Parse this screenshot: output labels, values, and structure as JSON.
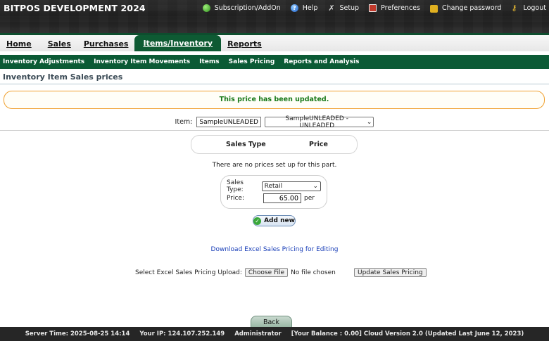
{
  "header": {
    "brand": "BITPOS DEVELOPMENT 2024",
    "links": {
      "subscription": "Subscription/AddOn",
      "help": "Help",
      "setup": "Setup",
      "preferences": "Preferences",
      "change_password": "Change password",
      "logout": "Logout"
    }
  },
  "menu": {
    "home": "Home",
    "sales": "Sales",
    "purchases": "Purchases",
    "items_inventory": "Items/Inventory",
    "reports": "Reports"
  },
  "submenu": {
    "adjustments": "Inventory Adjustments",
    "movements": "Inventory Item Movements",
    "items": "Items",
    "sales_pricing": "Sales Pricing",
    "reports": "Reports and Analysis"
  },
  "page": {
    "title": "Inventory Item Sales prices",
    "notice": "This price has been updated.",
    "item_label": "Item:",
    "item_code": "SampleUNLEADED",
    "item_selected": "SampleUNLEADED - UNLEADED",
    "col_sales_type": "Sales Type",
    "col_price": "Price",
    "no_prices": "There are no prices set up for this part.",
    "sales_type_label": "Sales Type:",
    "sales_type_value": "Retail",
    "price_label": "Price:",
    "price_value": "65.00",
    "per_label": "per",
    "add_new": "Add new",
    "download_link": "Download Excel Sales Pricing for Editing",
    "upload_label": "Select Excel Sales Pricing Upload:",
    "choose_file": "Choose File",
    "no_file": "No file chosen",
    "update_button": "Update Sales Pricing",
    "back_button": "Back"
  },
  "footer": {
    "server_time": "Server Time: 2025-08-25 14:14",
    "ip": "Your IP: 124.107.252.149",
    "user": "Administrator",
    "balance": "[Your Balance : 0.00] Cloud Version 2.0 (Updated Last June 12, 2023)"
  }
}
